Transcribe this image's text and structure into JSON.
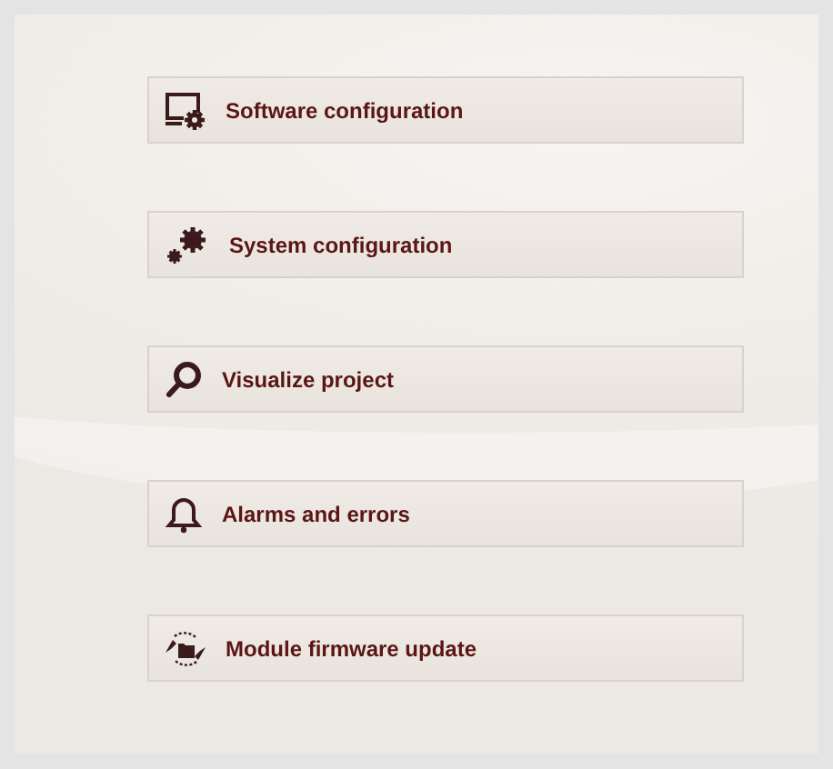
{
  "menu": [
    {
      "label": "Software configuration",
      "kind": "software"
    },
    {
      "label": "System configuration",
      "kind": "system"
    },
    {
      "label": "Visualize project",
      "kind": "visualize"
    },
    {
      "label": "Alarms and errors",
      "kind": "alarms"
    },
    {
      "label": "Module firmware update",
      "kind": "firmware"
    }
  ]
}
